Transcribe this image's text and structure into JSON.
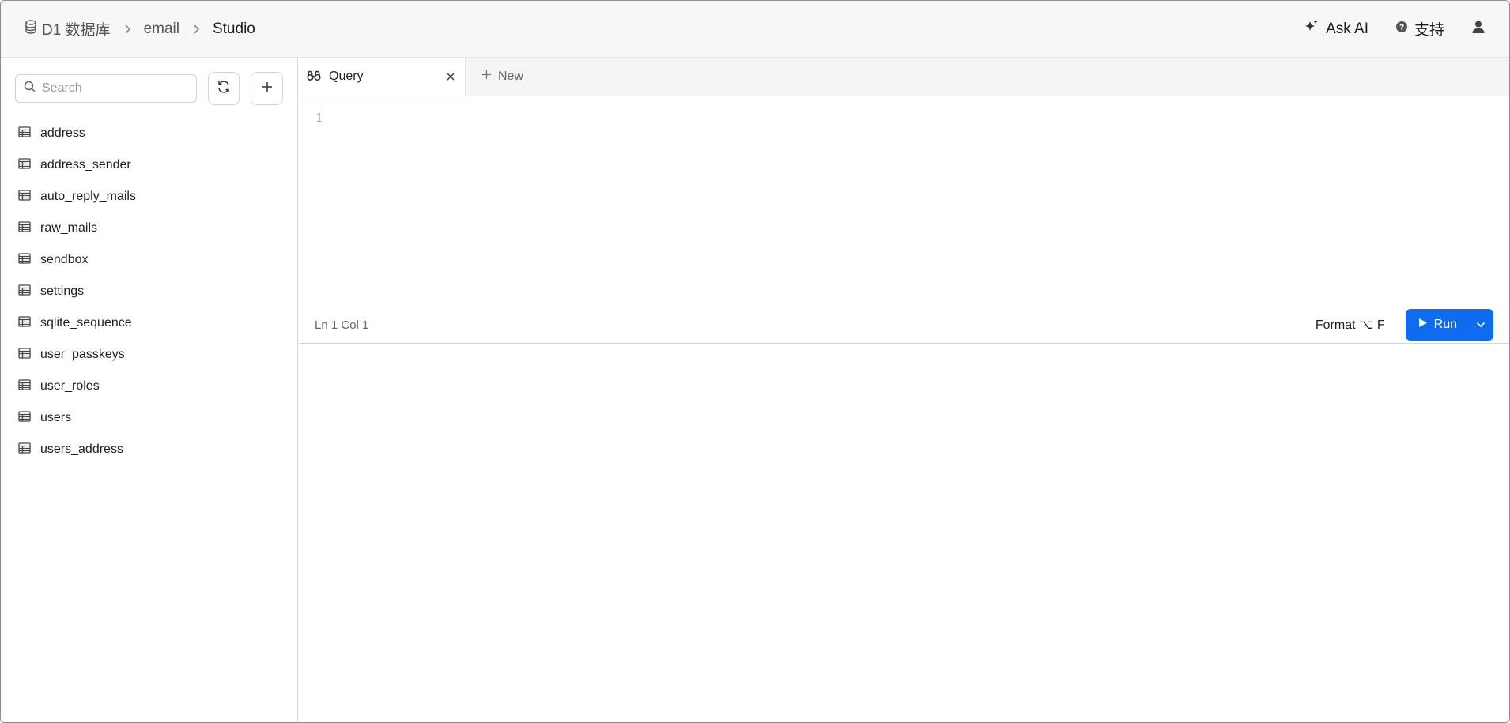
{
  "header": {
    "breadcrumb": [
      {
        "label": "D1 数据库",
        "icon": "database-icon"
      },
      {
        "label": "email"
      },
      {
        "label": "Studio"
      }
    ],
    "ask_ai_label": "Ask AI",
    "support_label": "支持"
  },
  "sidebar": {
    "search_placeholder": "Search",
    "tables": [
      "address",
      "address_sender",
      "auto_reply_mails",
      "raw_mails",
      "sendbox",
      "settings",
      "sqlite_sequence",
      "user_passkeys",
      "user_roles",
      "users",
      "users_address"
    ]
  },
  "tabs": {
    "active_label": "Query",
    "new_label": "New"
  },
  "editor": {
    "line_number": "1",
    "cursor_position": "Ln 1 Col 1",
    "format_label": "Format ⌥ F",
    "run_label": "Run"
  },
  "colors": {
    "accent": "#0f6cf0"
  }
}
